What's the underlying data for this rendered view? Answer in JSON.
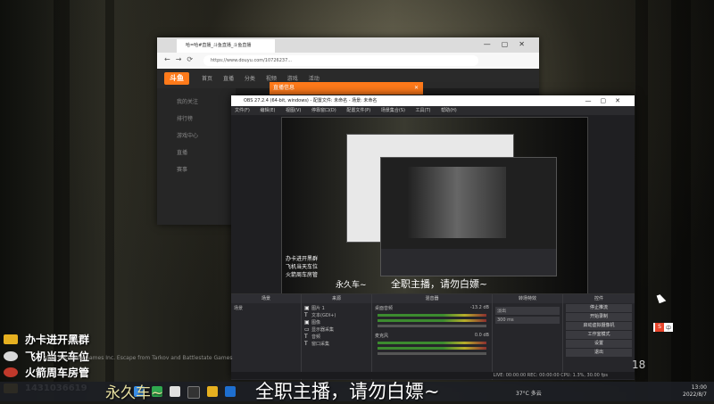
{
  "overlay": {
    "promos": [
      {
        "text": "办卡进开黑群",
        "color": "#e6b020"
      },
      {
        "text": "飞机当天车位",
        "color": "#d8d8d8"
      },
      {
        "text": "火箭周车房管",
        "color": "#c0392b"
      },
      {
        "text": "1431036619",
        "color": "#e6b020"
      }
    ],
    "side_sub": "永久车~",
    "subtitle_main": "全职主播，请勿白嫖~",
    "copyright": "2022 Bethesda Games Inc. Escape from Tarkov and Battlestate Games"
  },
  "browser": {
    "tab_title": "哈=哈#直播_斗鱼直播_斗鱼直播",
    "url": "https://www.douyu.com/10726237...",
    "logo": "斗鱼",
    "menu": [
      "首页",
      "直播",
      "分类",
      "视频",
      "游戏",
      "活动"
    ],
    "side_items": [
      "我的关注",
      "排行榜",
      "游戏中心",
      "直播",
      "赛事"
    ]
  },
  "popup": {
    "title": "直播信息"
  },
  "obs": {
    "title": "OBS 27.2.4 (64-bit, windows) - 配置文件: 未命名 - 场景: 未命名",
    "menu": [
      "文件(F)",
      "编辑(E)",
      "视图(V)",
      "停靠窗口(D)",
      "配置文件(P)",
      "场景集合(S)",
      "工具(T)",
      "帮助(H)"
    ],
    "preview_promos": [
      "办卡进开黑群",
      "飞机当天车位",
      "火箭周车房管"
    ],
    "preview_sub": "全职主播，请勿白嫖~",
    "preview_side": "永久车~",
    "docks": {
      "scenes": {
        "title": "场景",
        "items": [
          "场景"
        ]
      },
      "sources": {
        "title": "来源",
        "items": [
          "图片 1",
          "文本(GDI+)",
          "图像",
          "显示器采集",
          "音频",
          "窗口采集"
        ]
      },
      "mixer": {
        "title": "混音器",
        "tracks": [
          {
            "name": "桌面音频",
            "db": "-13.2 dB"
          },
          {
            "name": "麦克风",
            "db": "0.0 dB"
          }
        ]
      },
      "transitions": {
        "title": "转场特效",
        "type": "淡出",
        "duration": "300 ms"
      },
      "controls": {
        "title": "控件",
        "buttons": [
          "停止推流",
          "开始录制",
          "启动虚拟摄像机",
          "工作室模式",
          "设置",
          "退出"
        ]
      }
    },
    "status": "LIVE: 00:00:00   REC: 00:00:00   CPU: 1.3%, 30.00 fps"
  },
  "popup_preview_label": "来源",
  "taskbar": {
    "weather": "37°C  多云",
    "time": "13:00",
    "date": "2022/8/7"
  },
  "ime": {
    "label": "中"
  },
  "fps_badge": "18"
}
